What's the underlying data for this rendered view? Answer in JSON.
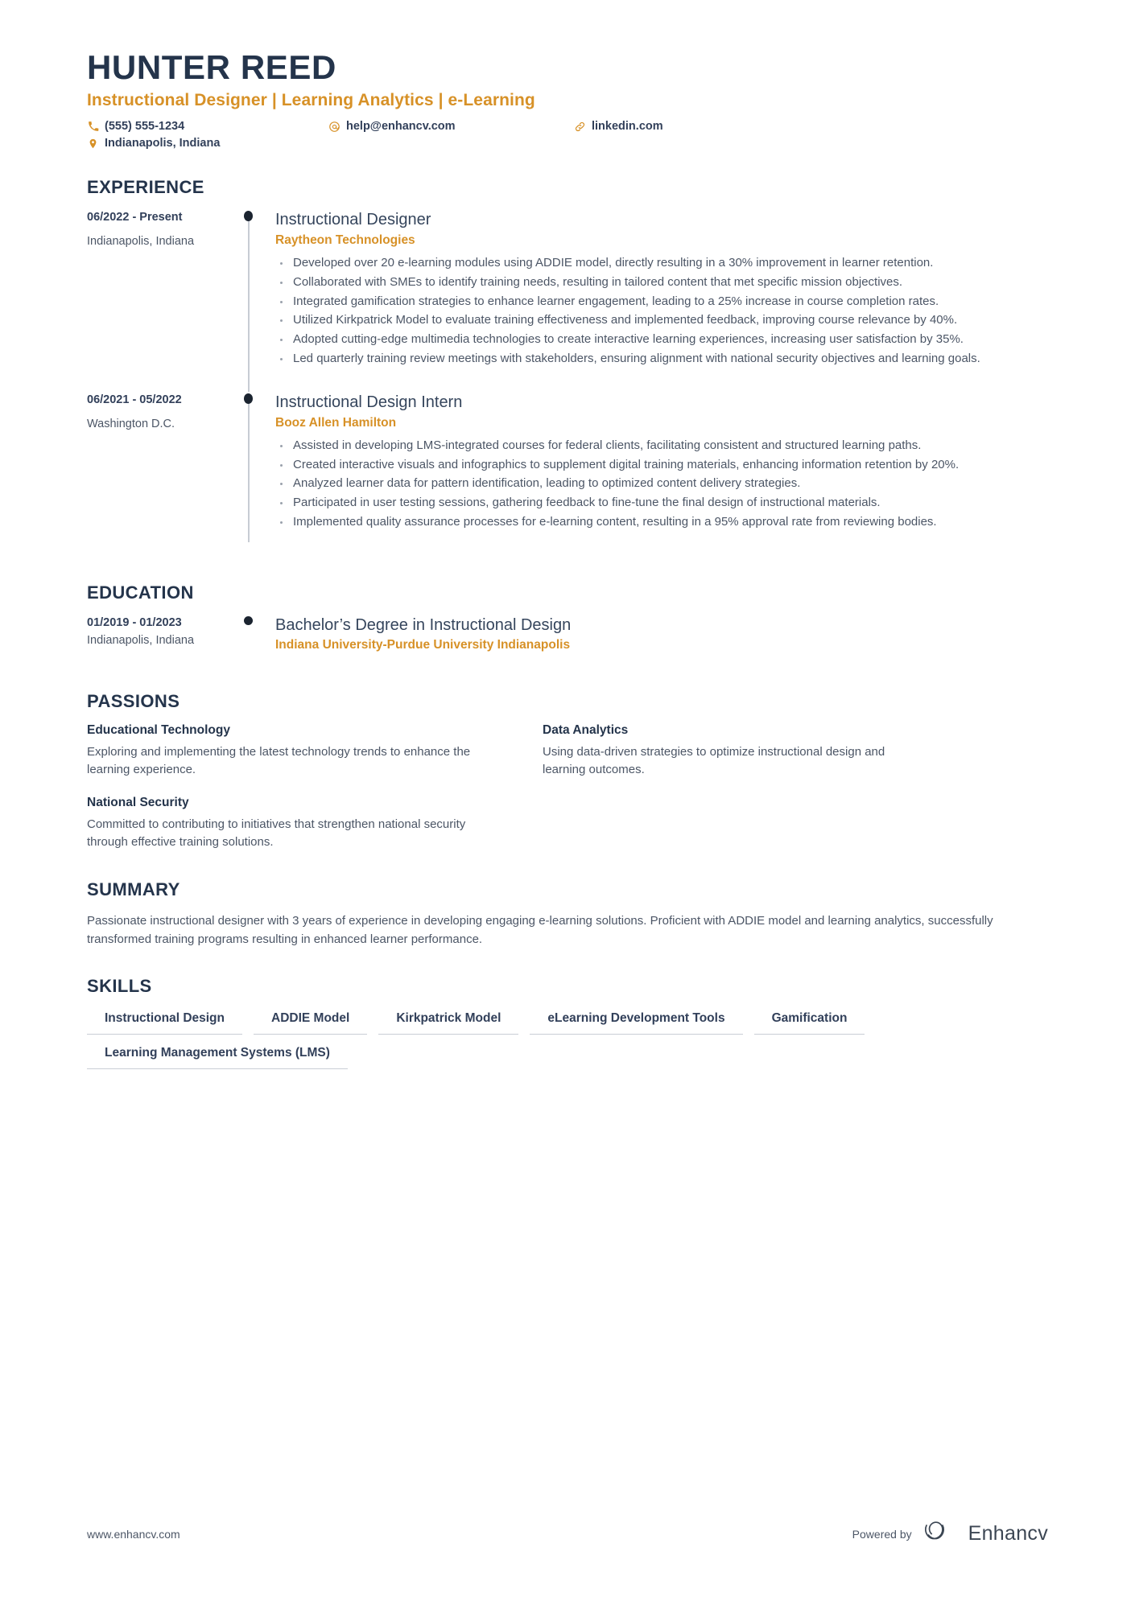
{
  "header": {
    "name": "HUNTER REED",
    "headline": "Instructional Designer | Learning Analytics | e-Learning",
    "contacts": [
      {
        "icon": "phone-icon",
        "text": "(555) 555-1234"
      },
      {
        "icon": "email-icon",
        "text": "help@enhancv.com"
      },
      {
        "icon": "link-icon",
        "text": "linkedin.com"
      },
      {
        "icon": "location-icon",
        "text": "Indianapolis, Indiana"
      }
    ]
  },
  "sections": {
    "experience": {
      "title": "EXPERIENCE",
      "entries": [
        {
          "date": "06/2022 - Present",
          "location": "Indianapolis, Indiana",
          "role": "Instructional Designer",
          "organization": "Raytheon Technologies",
          "bullets": [
            "Developed over 20 e-learning modules using ADDIE model, directly resulting in a 30% improvement in learner retention.",
            "Collaborated with SMEs to identify training needs, resulting in tailored content that met specific mission objectives.",
            "Integrated gamification strategies to enhance learner engagement, leading to a 25% increase in course completion rates.",
            "Utilized Kirkpatrick Model to evaluate training effectiveness and implemented feedback, improving course relevance by 40%.",
            "Adopted cutting-edge multimedia technologies to create interactive learning experiences, increasing user satisfaction by 35%.",
            "Led quarterly training review meetings with stakeholders, ensuring alignment with national security objectives and learning goals."
          ]
        },
        {
          "date": "06/2021 - 05/2022",
          "location": "Washington D.C.",
          "role": "Instructional Design Intern",
          "organization": "Booz Allen Hamilton",
          "bullets": [
            "Assisted in developing LMS-integrated courses for federal clients, facilitating consistent and structured learning paths.",
            "Created interactive visuals and infographics to supplement digital training materials, enhancing information retention by 20%.",
            "Analyzed learner data for pattern identification, leading to optimized content delivery strategies.",
            "Participated in user testing sessions, gathering feedback to fine-tune the final design of instructional materials.",
            "Implemented quality assurance processes for e-learning content, resulting in a 95% approval rate from reviewing bodies."
          ]
        }
      ]
    },
    "education": {
      "title": "EDUCATION",
      "entries": [
        {
          "date": "01/2019 - 01/2023",
          "location": "Indianapolis, Indiana",
          "degree": "Bachelor’s Degree in Instructional Design",
          "institution": "Indiana University-Purdue University Indianapolis"
        }
      ]
    },
    "passions": {
      "title": "PASSIONS",
      "items": [
        {
          "title": "Educational Technology",
          "description": "Exploring and implementing the latest technology trends to enhance the learning experience."
        },
        {
          "title": "Data Analytics",
          "description": "Using data-driven strategies to optimize instructional design and learning outcomes."
        },
        {
          "title": "National Security",
          "description": "Committed to contributing to initiatives that strengthen national security through effective training solutions."
        }
      ]
    },
    "summary": {
      "title": "SUMMARY",
      "text": "Passionate instructional designer with 3 years of experience in developing engaging e-learning solutions. Proficient with ADDIE model and learning analytics, successfully transformed training programs resulting in enhanced learner performance."
    },
    "skills": {
      "title": "SKILLS",
      "items": [
        "Instructional Design",
        "ADDIE Model",
        "Kirkpatrick Model",
        "eLearning Development Tools",
        "Gamification",
        "Learning Management Systems (LMS)"
      ]
    }
  },
  "footer": {
    "url": "www.enhancv.com",
    "powered_by": "Powered by",
    "brand": "Enhancv"
  },
  "colors": {
    "accent": "#d79127",
    "heading": "#24344b",
    "body": "#4c5666",
    "rule": "#c9ced6"
  }
}
